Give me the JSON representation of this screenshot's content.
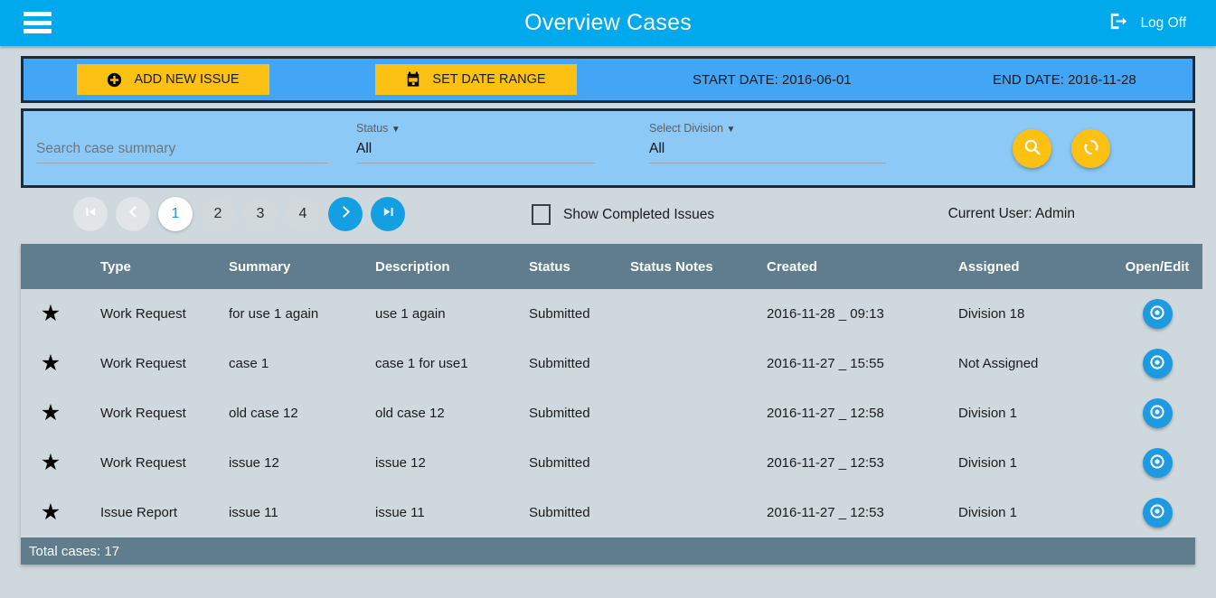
{
  "appbar": {
    "menu_icon": "hamburger-menu-icon",
    "title": "Overview Cases",
    "logoff_icon": "logout-icon",
    "logoff_label": "Log Off"
  },
  "toolbar": {
    "add_issue_icon": "plus-circle-icon",
    "add_issue_label": "ADD NEW ISSUE",
    "date_range_icon": "calendar-icon",
    "date_range_label": "SET DATE RANGE",
    "start_date_label": "START DATE: 2016-06-01",
    "end_date_label": "END DATE: 2016-11-28"
  },
  "filters": {
    "search_placeholder": "Search case summary",
    "search_value": "",
    "status_label": "Status",
    "status_value": "All",
    "division_label": "Select Division",
    "division_value": "All",
    "caret": "▼",
    "search_button_icon": "search-icon",
    "refresh_button_icon": "refresh-icon"
  },
  "pagination": {
    "first_icon": "first-page-icon",
    "prev_icon": "chevron-left-icon",
    "pages": [
      "1",
      "2",
      "3",
      "4"
    ],
    "active_page": "1",
    "next_icon": "chevron-right-icon",
    "last_icon": "last-page-icon"
  },
  "options": {
    "show_completed_label": "Show Completed Issues",
    "show_completed_checked": false,
    "current_user_label": "Current User: Admin"
  },
  "table": {
    "columns": [
      "",
      "Type",
      "Summary",
      "Description",
      "Status",
      "Status Notes",
      "Created",
      "Assigned",
      "Open/Edit"
    ],
    "star_glyph": "★",
    "open_icon": "eye-icon",
    "rows": [
      {
        "type": "Work Request",
        "summary": "for use 1 again",
        "description": "use 1 again",
        "status": "Submitted",
        "status_notes": "",
        "created": "2016-11-28 _ 09:13",
        "assigned": "Division 18"
      },
      {
        "type": "Work Request",
        "summary": "case 1",
        "description": "case 1 for use1",
        "status": "Submitted",
        "status_notes": "",
        "created": "2016-11-27 _ 15:55",
        "assigned": "Not Assigned"
      },
      {
        "type": "Work Request",
        "summary": "old case 12",
        "description": "old case 12",
        "status": "Submitted",
        "status_notes": "",
        "created": "2016-11-27 _ 12:58",
        "assigned": "Division 1"
      },
      {
        "type": "Work Request",
        "summary": "issue 12",
        "description": "issue 12",
        "status": "Submitted",
        "status_notes": "",
        "created": "2016-11-27 _ 12:53",
        "assigned": "Division 1"
      },
      {
        "type": "Issue Report",
        "summary": "issue 11",
        "description": "issue 11",
        "status": "Submitted",
        "status_notes": "",
        "created": "2016-11-27 _ 12:53",
        "assigned": "Division 1"
      }
    ],
    "footer_label": "Total cases: 17"
  },
  "colors": {
    "appbar_blue": "#00a8ec",
    "toolbar_blue": "#42a5f5",
    "filter_blue": "#8dc9f7",
    "accent_yellow": "#fdc113",
    "table_header_slate": "#5f7d8c",
    "table_row_gray": "#cfd8dc",
    "button_blue": "#1e9ae0",
    "page_background": "#cfd8dc"
  }
}
